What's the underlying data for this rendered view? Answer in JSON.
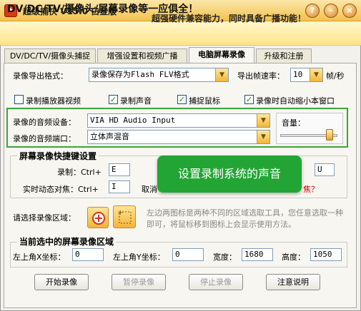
{
  "window": {
    "title": "超级捕快 V15.0 白金版",
    "icon": "app-logo-icon",
    "buttons": [
      "?",
      "–",
      "×"
    ]
  },
  "banner": {
    "line1": "DV/DC/TV/摄像头/屏幕录像等一应俱全！",
    "line2": "超强硬件兼容能力，同时具备广播功能！"
  },
  "tabs": [
    "DV/DC/TV/摄像头捕捉",
    "增强设置和视频广播",
    "电脑屏幕录像",
    "升级和注册"
  ],
  "active_tab": 2,
  "export": {
    "format_label": "录像导出格式：",
    "format_value": "录像保存为Flash FLV格式",
    "fps_label": "导出帧速率：",
    "fps_value": "10",
    "fps_unit": "帧/秒"
  },
  "options": [
    {
      "label": "录制播放器视频",
      "checked": false
    },
    {
      "label": "录制声音",
      "checked": true
    },
    {
      "label": "捕捉鼠标",
      "checked": true
    },
    {
      "label": "录像时自动缩小本窗口",
      "checked": true
    }
  ],
  "audio": {
    "device_label": "录像的音频设备：",
    "device_value": "VIA HD Audio Input",
    "port_label": "录像的音频端口：",
    "port_value": "立体声混音",
    "volume_label": "音量：",
    "volume_level": 0.92
  },
  "hotkeys": {
    "title": "屏幕录像快捷键设置",
    "record_label": "录制：Ctrl+",
    "record_value": "E",
    "focus_label": "实时动态对焦：Ctrl+",
    "focus_value": "I",
    "cancel_label": "取消",
    "right_value": "U",
    "partial_suffix": "焦？"
  },
  "callout": "设置录制系统的声音",
  "region": {
    "label": "请选择录像区域：",
    "tip": "左边两图标是两种不同的区域选取工具，您任意选取一种即可，将鼠标移到图标上会显示使用方法。"
  },
  "current_region": {
    "title": "当前选中的屏幕录像区域",
    "x_label": "左上角X坐标：",
    "x_value": "0",
    "y_label": "左上角Y坐标：",
    "y_value": "0",
    "w_label": "宽度：",
    "w_value": "1680",
    "h_label": "高度：",
    "h_value": "1050"
  },
  "actions": [
    "开始录像",
    "暂停录像",
    "停止录像",
    "注意说明"
  ],
  "colors": {
    "accent_green": "#22a534",
    "title_gold": "#f3c24f"
  }
}
